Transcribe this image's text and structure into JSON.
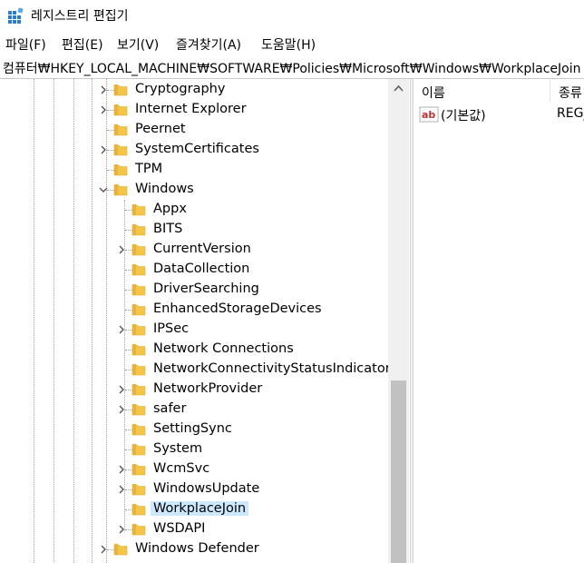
{
  "window": {
    "title": "레지스트리 편집기",
    "icon": "registry-editor-icon"
  },
  "menu": [
    "파일(F)",
    "편집(E)",
    "보기(V)",
    "즐겨찾기(A)",
    "도움말(H)"
  ],
  "address": "컴퓨터₩HKEY_LOCAL_MACHINE₩SOFTWARE₩Policies₩Microsoft₩Windows₩WorkplaceJoin",
  "tree": {
    "microsoft_children": [
      {
        "label": "Cryptography",
        "expandable": true
      },
      {
        "label": "Internet Explorer",
        "expandable": true
      },
      {
        "label": "Peernet",
        "expandable": false
      },
      {
        "label": "SystemCertificates",
        "expandable": true
      },
      {
        "label": "TPM",
        "expandable": false
      },
      {
        "label": "Windows",
        "expandable": true,
        "expanded": true
      }
    ],
    "windows_children": [
      {
        "label": "Appx",
        "expandable": false
      },
      {
        "label": "BITS",
        "expandable": false
      },
      {
        "label": "CurrentVersion",
        "expandable": true
      },
      {
        "label": "DataCollection",
        "expandable": false
      },
      {
        "label": "DriverSearching",
        "expandable": false
      },
      {
        "label": "EnhancedStorageDevices",
        "expandable": false
      },
      {
        "label": "IPSec",
        "expandable": true
      },
      {
        "label": "Network Connections",
        "expandable": false
      },
      {
        "label": "NetworkConnectivityStatusIndicator",
        "expandable": false
      },
      {
        "label": "NetworkProvider",
        "expandable": true
      },
      {
        "label": "safer",
        "expandable": true
      },
      {
        "label": "SettingSync",
        "expandable": false
      },
      {
        "label": "System",
        "expandable": false
      },
      {
        "label": "WcmSvc",
        "expandable": true
      },
      {
        "label": "WindowsUpdate",
        "expandable": true
      },
      {
        "label": "WorkplaceJoin",
        "expandable": false,
        "selected": true
      },
      {
        "label": "WSDAPI",
        "expandable": true
      }
    ],
    "after_windows": [
      {
        "label": "Windows Defender",
        "expandable": true
      }
    ]
  },
  "list": {
    "columns": [
      "이름",
      "종류"
    ],
    "rows": [
      {
        "icon": "string-value-icon",
        "name": "(기본값)",
        "type": "REG_SZ"
      }
    ]
  },
  "colors": {
    "folder": "#f3c64a",
    "selection": "#cce8ff",
    "scrollbar_thumb": "#c1c1c1",
    "string_icon": "#c03030"
  }
}
